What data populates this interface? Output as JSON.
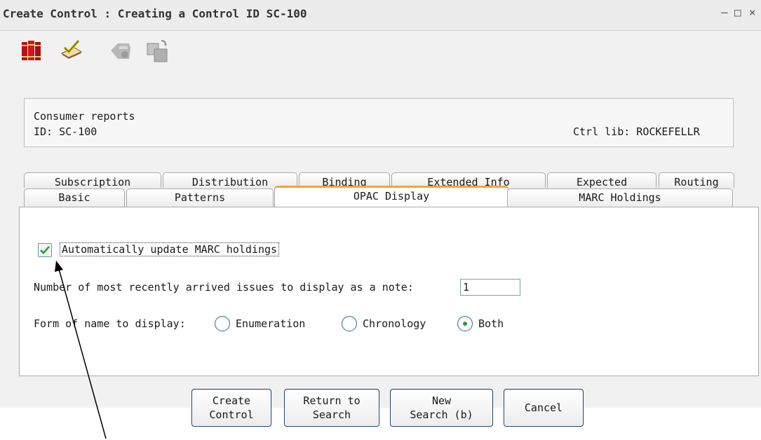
{
  "window": {
    "title": "Create Control : Creating a Control ID SC-100",
    "minimize": "–",
    "maximize": "□",
    "close": "×"
  },
  "toolbar": {
    "icons": [
      "books-icon",
      "edit-check-icon",
      "hand-icon",
      "copy-icon"
    ]
  },
  "info": {
    "title": "Consumer reports",
    "id": "ID: SC-100",
    "ctrl_lib": "Ctrl lib: ROCKEFELLR"
  },
  "tabs": {
    "row1": [
      "Subscription",
      "Distribution",
      "Binding",
      "Extended Info",
      "Expected",
      "Routing"
    ],
    "row2": [
      "Basic",
      "Patterns",
      "OPAC Display",
      "MARC Holdings"
    ],
    "active": "OPAC Display"
  },
  "form": {
    "auto_update_label": "Automatically update MARC holdings",
    "auto_update_checked": true,
    "issues_label": "Number of most recently arrived issues to display as a note:",
    "issues_value": "1",
    "form_name_label": "Form of name to display:",
    "radio_options": [
      "Enumeration",
      "Chronology",
      "Both"
    ],
    "radio_selected": "Both"
  },
  "buttons": {
    "create_line1": "Create",
    "create_line2": "Control",
    "return_line1": "Return to",
    "return_line2": "Search",
    "new_line1": "New",
    "new_line2": "Search (b)",
    "cancel": "Cancel"
  },
  "colors": {
    "active_tab_accent": "#f1a43c",
    "button_border": "#1c3c66",
    "check_color": "#2a9b3a"
  }
}
